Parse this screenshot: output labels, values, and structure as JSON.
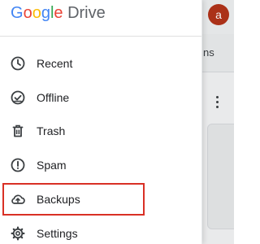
{
  "drawer": {
    "brand": {
      "google_letters": [
        "G",
        "o",
        "o",
        "g",
        "l",
        "e"
      ],
      "product": "Drive"
    },
    "items": [
      {
        "label": "Recent",
        "icon": "clock-icon"
      },
      {
        "label": "Offline",
        "icon": "offline-check-icon"
      },
      {
        "label": "Trash",
        "icon": "trash-icon"
      },
      {
        "label": "Spam",
        "icon": "spam-icon"
      },
      {
        "label": "Backups",
        "icon": "cloud-upload-icon"
      },
      {
        "label": "Settings",
        "icon": "gear-icon"
      }
    ],
    "highlighted_item": "Backups"
  },
  "background": {
    "avatar_initial": "a",
    "tab_text": "ns"
  },
  "colors": {
    "highlight_border": "#d93025",
    "avatar": "#b5341a",
    "label": "#202124",
    "icon": "#3c4043"
  }
}
